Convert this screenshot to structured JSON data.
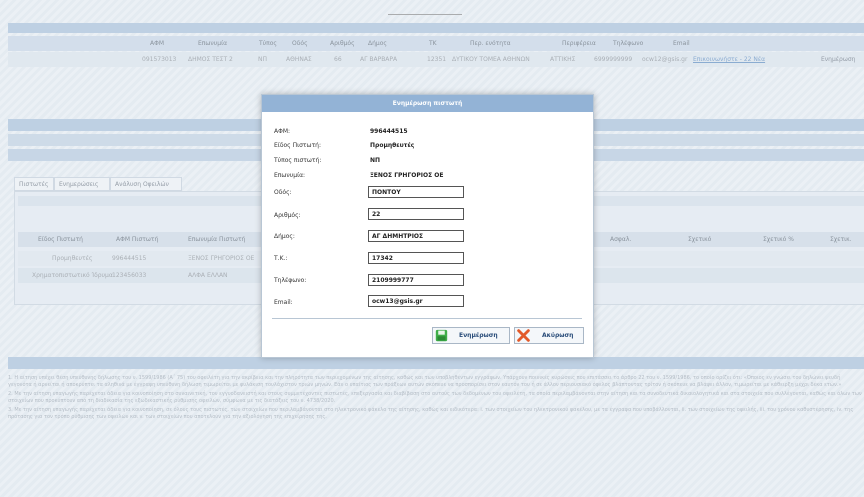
{
  "summary": {
    "headers": [
      "ΑΦΜ",
      "Επωνυμία",
      "Τύπος",
      "Οδός",
      "Αριθμός",
      "Δήμος",
      "ΤΚ",
      "Περ. ενότητα",
      "Περιφέρεια",
      "Τηλέφωνο",
      "Email"
    ],
    "values": [
      "091573013",
      "ΔΗΜΟΣ ΤΕΣΤ 2",
      "ΝΠ",
      "ΑΘΗΝΑΣ",
      "66",
      "ΑΓ ΒΑΡΒΑΡΑ",
      "12351",
      "ΔΥΤΙΚΟΥ ΤΟΜΕΑ ΑΘΗΝΩΝ",
      "ΑΤΤΙΚΗΣ",
      "6999999999",
      "ocw12@gsis.gr"
    ],
    "link": "Επικοινωνήστε - 22 Νέα",
    "action": "Ενημέρωση"
  },
  "tabs": [
    "Πιστωτές",
    "Ενημερώσεις",
    "Ανάλυση Οφειλών"
  ],
  "creditors_table": {
    "headers": [
      "Είδος Πιστωτή",
      "ΑΦΜ Πιστωτή",
      "Επωνυμία Πιστωτή",
      "Ασφαλ.",
      "Σχετικό",
      "Σχετικό %",
      "Σχετικ."
    ],
    "rows": [
      [
        "Προμηθευτές",
        "996444515",
        "ΞΕΝΟΣ ΓΡΗΓΟΡΙΟΣ ΟΕ"
      ],
      [
        "Χρηματοπιστωτικό Ίδρυμα",
        "123456033",
        "ΑΛΦΑ ΕΛΛΑΝ"
      ]
    ]
  },
  "notes": [
    "1. Η αίτηση υπέχει θέση υπεύθυνης δήλωσης του ν. 1599/1986 (Α΄ 75) του οφειλέτη για την ακρίβεια και την πληρότητα των περιεχομένων της αίτησης, καθώς και των υποβληθέντων εγγράφων. Υπάρχουν ποινικές κυρώσεις που επιτάσσει το άρθρο 22 του ν. 1599/1986, το οποίο ορίζει ότι: «Όποιος εν γνώσει του δηλώνει ψευδή γεγονότα ή αρνείται ή αποκρύπτει τα αληθινά με έγγραφη υπεύθυνη δήλωση τιμωρείται με φυλάκιση τουλάχιστον τριών μηνών. Εάν ο υπαίτιος των πράξεων αυτών σκόπευε να προσπορίσει στον εαυτόν του ή σε άλλον περιουσιακό όφελος βλάπτοντας τρίτον ή σκόπευε να βλάψει άλλον, τιμωρείται με κάθειρξη μέχρι δέκα ετών.»",
    "2. Με την αίτηση υπαγωγής παρέχεται άδεια για κοινοποίηση στο συναινετική, τον εγγυοδανειστή και στους συμμετέχοντες πιστωτές, επεξεργασία και διαβίβαση στο αυτούς των δεδομένων του οφειλέτη, τα οποία περιλαμβάνονται στην αίτηση και τα συνοδευτικά δικαιολογητικά και στα στοιχεία που συλλέγονται, καθώς και όλων των στοιχείων που προκύπτουν από τη διαδικασία της εξωδικαστικής ρύθμισης οφειλών, σύμφωνα με τις διατάξεις του ν. 4738/2020.",
    "3. Με την αίτηση υπαγωγής παρέχεται άδεια για κοινοποίηση, σε όλους τους πιστωτές, των στοιχείων που περιλαμβάνονται στο ηλεκτρονικό φάκελο της αίτησης, καθώς και ειδικότερα: i. των στοιχείων του ηλεκτρονικού φακέλου, με τα έγγραφα που υποβάλλονται, ii. των στοιχείων της οφειλής, iii. του χρόνου καθυστέρησης, iv. της πρότασης για τον τρόπο ρύθμισης των οφειλών και v. των στοιχείων που αποτελούν για την αξιολόγηση της επιχείρησης της."
  ],
  "modal": {
    "title": "Ενημέρωση πιστωτή",
    "static_fields": [
      {
        "label": "ΑΦΜ:",
        "value": "996444515"
      },
      {
        "label": "Είδος Πιστωτή:",
        "value": "Προμηθευτές"
      },
      {
        "label": "Τύπος πιστωτή:",
        "value": "ΝΠ"
      },
      {
        "label": "Επωνυμία:",
        "value": "ΞΕΝΟΣ ΓΡΗΓΟΡΙΟΣ ΟΕ"
      }
    ],
    "input_fields": [
      {
        "label": "Οδός:",
        "value": "ΠΟΝΤΟΥ"
      },
      {
        "label": "Αριθμός:",
        "value": "22"
      },
      {
        "label": "Δήμος:",
        "value": "ΑΓ ΔΗΜΗΤΡΙΟΣ"
      },
      {
        "label": "Τ.Κ.:",
        "value": "17342"
      },
      {
        "label": "Τηλέφωνο:",
        "value": "2109999777"
      },
      {
        "label": "Email:",
        "value": "ocw13@gsis.gr"
      }
    ],
    "update_label": "Ενημέρωση",
    "cancel_label": "Ακύρωση"
  }
}
